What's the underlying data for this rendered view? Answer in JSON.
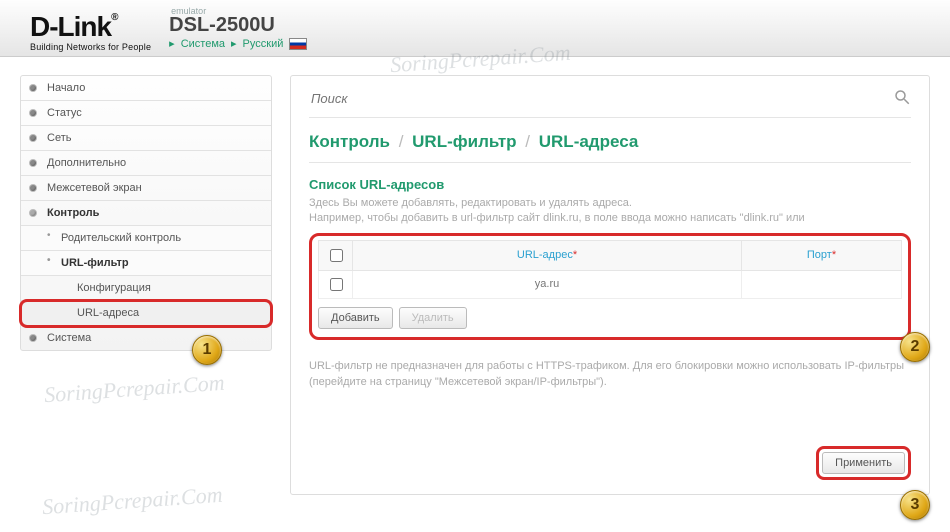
{
  "watermark": "SoringPcrepair.Com",
  "header": {
    "logo_main": "D-Link",
    "logo_sub": "Building Networks for People",
    "emulator_label": "emulator",
    "model": "DSL-2500U",
    "crumb_system": "Система",
    "crumb_lang": "Русский"
  },
  "sidebar": {
    "items": [
      {
        "label": "Начало",
        "type": "top"
      },
      {
        "label": "Статус",
        "type": "top"
      },
      {
        "label": "Сеть",
        "type": "top"
      },
      {
        "label": "Дополнительно",
        "type": "top"
      },
      {
        "label": "Межсетевой экран",
        "type": "top"
      },
      {
        "label": "Контроль",
        "type": "top open"
      },
      {
        "label": "Родительский контроль",
        "type": "sub"
      },
      {
        "label": "URL-фильтр",
        "type": "sub active"
      },
      {
        "label": "Конфигурация",
        "type": "sub2"
      },
      {
        "label": "URL-адреса",
        "type": "sub2 highlight callout"
      },
      {
        "label": "Система",
        "type": "top"
      }
    ]
  },
  "search": {
    "placeholder": "Поиск"
  },
  "breadcrumb": {
    "parts": [
      "Контроль",
      "URL-фильтр",
      "URL-адреса"
    ]
  },
  "section": {
    "title": "Список URL-адресов",
    "desc_line1": "Здесь Вы можете добавлять, редактировать и удалять адреса.",
    "desc_line2": "Например, чтобы добавить в url-фильтр сайт dlink.ru, в поле ввода можно написать \"dlink.ru\" или"
  },
  "table": {
    "col_url": "URL-адрес",
    "col_port": "Порт",
    "rows": [
      {
        "url": "ya.ru",
        "port": ""
      }
    ],
    "add_label": "Добавить",
    "delete_label": "Удалить"
  },
  "note": "URL-фильтр не предназначен для работы с HTTPS-трафиком. Для его блокировки можно использовать IP-фильтры (перейдите на страницу \"Межсетевой экран/IP-фильтры\").",
  "apply_label": "Применить",
  "badges": {
    "b1": "1",
    "b2": "2",
    "b3": "3"
  }
}
